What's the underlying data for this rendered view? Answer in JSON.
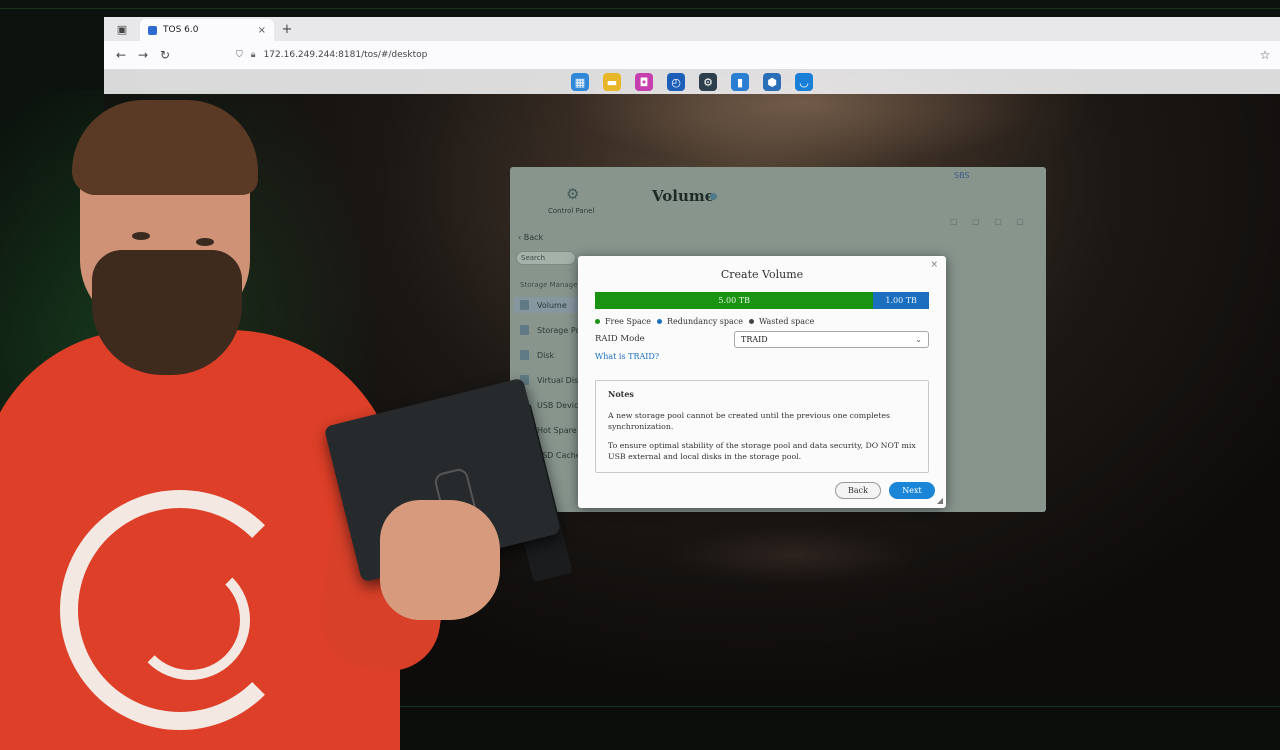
{
  "browser": {
    "tab_title": "TOS 6.0",
    "tab_close": "×",
    "new_tab": "+",
    "url": "172.16.249.244:8181/tos/#/desktop"
  },
  "icons": {
    "back": "arrow-left-icon",
    "forward": "arrow-right-icon",
    "reload": "reload-icon",
    "shield": "shield-icon",
    "lock": "lock-icon",
    "bookmark": "star-icon"
  },
  "dock": [
    {
      "name": "app-center-icon",
      "color": "#2f88d8"
    },
    {
      "name": "file-manager-icon",
      "color": "#e7b62b"
    },
    {
      "name": "media-icon",
      "color": "#c73fae"
    },
    {
      "name": "backup-icon",
      "color": "#1d5fb8"
    },
    {
      "name": "control-panel-icon",
      "color": "#2d3f4c"
    },
    {
      "name": "notes-icon",
      "color": "#2a7fd2"
    },
    {
      "name": "security-icon",
      "color": "#2a6fb8"
    },
    {
      "name": "support-icon",
      "color": "#1a7fd6"
    }
  ],
  "control_panel": {
    "label": "Control Panel",
    "back": "Back",
    "search_placeholder": "Search",
    "section": "Storage Manager",
    "heading": "Volume",
    "badge": "SBS",
    "items": [
      {
        "label": "Volume"
      },
      {
        "label": "Storage Pool"
      },
      {
        "label": "Disk"
      },
      {
        "label": "Virtual Disk"
      },
      {
        "label": "USB Devices"
      },
      {
        "label": "Hot Spare"
      },
      {
        "label": "SSD Cache"
      }
    ]
  },
  "dialog": {
    "title": "Create Volume",
    "close": "×",
    "capacity": {
      "free_label": "5.00 TB",
      "redundancy_label": "1.00 TB",
      "free_tb": 5.0,
      "redundancy_tb": 1.0,
      "free_color": "#1a9212",
      "redundancy_color": "#1b6fbe",
      "wasted_color": "#444444"
    },
    "legend": {
      "free": "Free Space",
      "redundancy": "Redundancy space",
      "wasted": "Wasted space"
    },
    "raid_mode_label": "RAID Mode",
    "raid_mode_value": "TRAID",
    "traid_link": "What is TRAID?",
    "notes_title": "Notes",
    "notes": [
      "A new storage pool cannot be created until the previous one completes synchronization.",
      "To ensure optimal stability of the storage pool and data security, DO NOT mix USB external and local disks in the storage pool."
    ],
    "back_button": "Back",
    "next_button": "Next"
  },
  "device_brand": "TERRAMASTER"
}
